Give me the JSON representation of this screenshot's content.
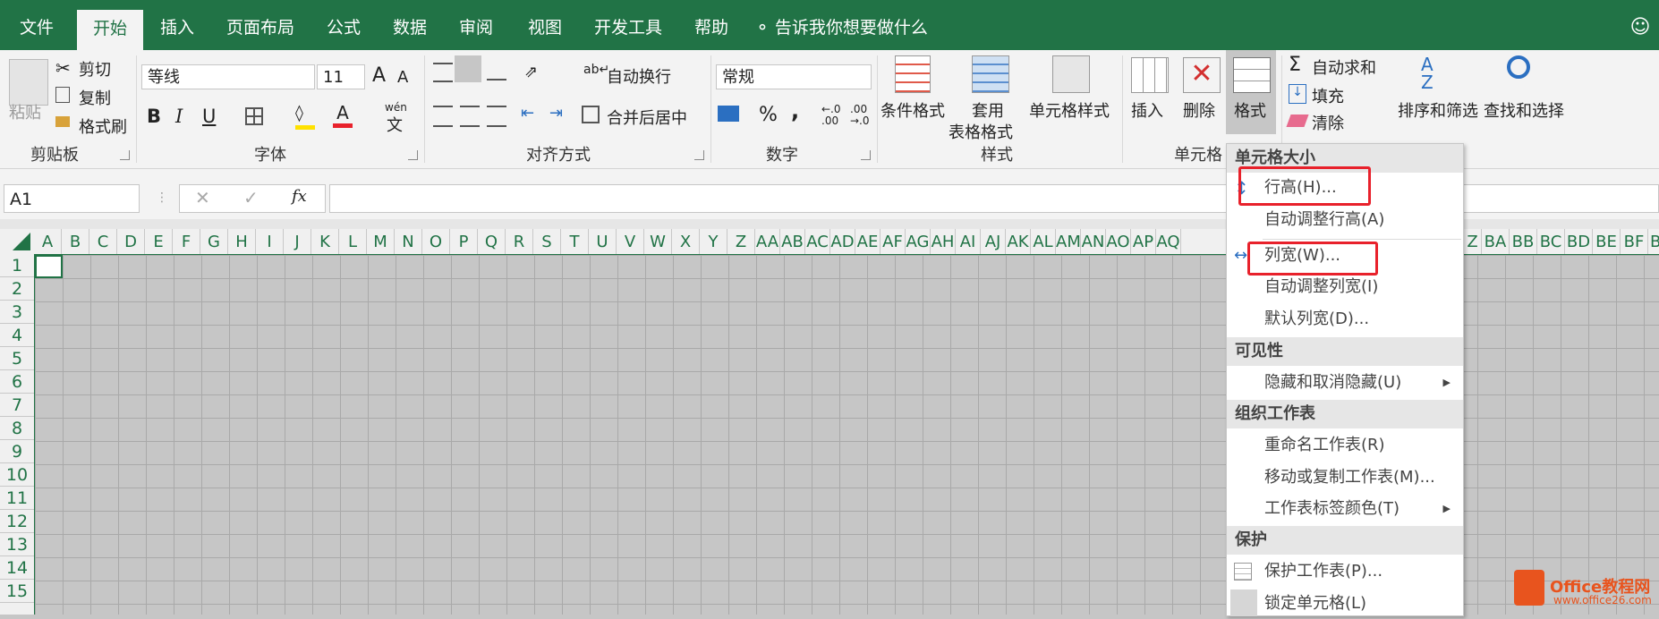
{
  "tabs": [
    "文件",
    "开始",
    "插入",
    "页面布局",
    "公式",
    "数据",
    "审阅",
    "视图",
    "开发工具",
    "帮助"
  ],
  "tell_me": "告诉我你想要做什么",
  "clipboard": {
    "paste": "粘贴",
    "cut": "剪切",
    "copy": "复制",
    "format_painter": "格式刷",
    "group": "剪贴板"
  },
  "font": {
    "name": "等线",
    "size": "11",
    "grow": "A",
    "shrink": "A",
    "bold": "B",
    "italic": "I",
    "underline": "U",
    "wen": "wén",
    "wen2": "文",
    "group": "字体"
  },
  "align": {
    "wrap": "自动换行",
    "merge": "合并后居中",
    "group": "对齐方式"
  },
  "number": {
    "format": "常规",
    "percent": "%",
    "comma": ",",
    "group": "数字"
  },
  "styles": {
    "conditional": "条件格式",
    "table_line1": "套用",
    "table_line2": "表格格式",
    "cell_styles": "单元格样式",
    "group": "样式"
  },
  "cells": {
    "insert": "插入",
    "delete": "删除",
    "format": "格式",
    "group": "单元格"
  },
  "editing": {
    "autosum": "自动求和",
    "fill": "填充",
    "clear": "清除",
    "sort": "排序和筛选",
    "find": "查找和选择"
  },
  "formula_bar": {
    "name_box": "A1",
    "fx": "fx"
  },
  "columns": [
    "A",
    "B",
    "C",
    "D",
    "E",
    "F",
    "G",
    "H",
    "I",
    "J",
    "K",
    "L",
    "M",
    "N",
    "O",
    "P",
    "Q",
    "R",
    "S",
    "T",
    "U",
    "V",
    "W",
    "X",
    "Y",
    "Z",
    "AA",
    "AB",
    "AC",
    "AD",
    "AE",
    "AF",
    "AG",
    "AH",
    "AI",
    "AJ",
    "AK",
    "AL",
    "AM",
    "AN",
    "AO",
    "AP",
    "AQ"
  ],
  "columns_right": [
    "Z",
    "BA",
    "BB",
    "BC",
    "BD",
    "BE",
    "BF",
    "BG"
  ],
  "rows": [
    "1",
    "2",
    "3",
    "4",
    "5",
    "6",
    "7",
    "8",
    "9",
    "10",
    "11",
    "12",
    "13",
    "14",
    "15"
  ],
  "menu": {
    "h_size": "单元格大小",
    "row_height": "行高(H)...",
    "autofit_row": "自动调整行高(A)",
    "col_width": "列宽(W)...",
    "autofit_col": "自动调整列宽(I)",
    "default_width": "默认列宽(D)...",
    "h_visibility": "可见性",
    "hide": "隐藏和取消隐藏(U)",
    "h_organize": "组织工作表",
    "rename": "重命名工作表(R)",
    "move_copy": "移动或复制工作表(M)...",
    "tab_color": "工作表标签颜色(T)",
    "h_protect": "保护",
    "protect_sheet": "保护工作表(P)...",
    "lock_cell": "锁定单元格(L)"
  },
  "watermark": {
    "brand": "Office教程网",
    "url": "www.office26.com"
  },
  "colors": {
    "accent": "#217346",
    "highlight": "#e8212b"
  }
}
